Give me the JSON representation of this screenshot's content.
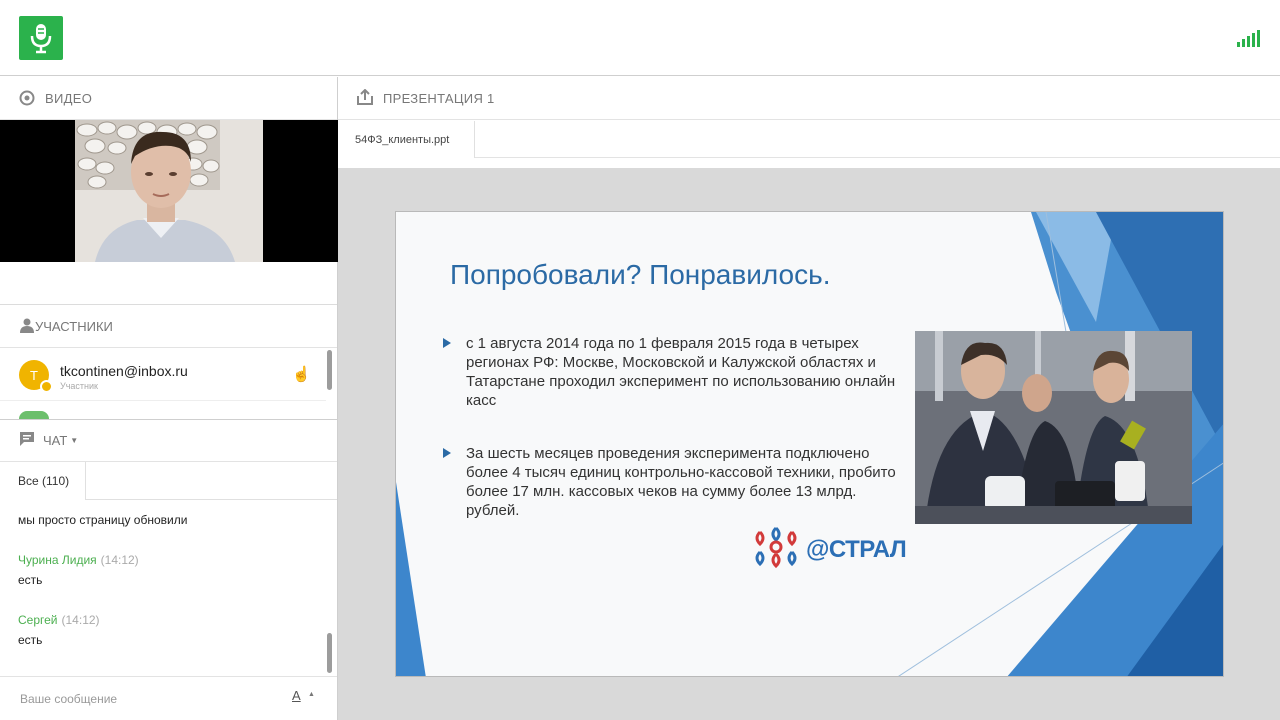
{
  "colors": {
    "brand_green": "#2bb24c",
    "accent_blue": "#2b6aa5",
    "author_green": "#4caf50"
  },
  "video": {
    "title": "ВИДЕО"
  },
  "participants": {
    "title": "УЧАСТНИКИ",
    "items": [
      {
        "initial": "T",
        "email": "tkcontinen@inbox.ru",
        "role": "Участник"
      }
    ]
  },
  "chat": {
    "title": "ЧАТ",
    "tab_all": "Все (110)",
    "messages": [
      {
        "author": "",
        "time": "",
        "text": "мы просто страницу обновили"
      },
      {
        "author": "Чурина Лидия",
        "time": "(14:12)",
        "text": "есть"
      },
      {
        "author": "Сергей",
        "time": "(14:12)",
        "text": "есть"
      }
    ],
    "input_placeholder": "Ваше сообщение",
    "format_label": "A"
  },
  "presentation": {
    "title": "ПРЕЗЕНТАЦИЯ 1",
    "file_tab": "54ФЗ_клиенты.ppt",
    "slide": {
      "title": "Попробовали? Понравилось.",
      "bullets": [
        "с 1 августа 2014 года по 1 февраля 2015 года в четырех регионах РФ: Москве, Московской и Калужской областях и Татарстане проходил эксперимент по использованию онлайн касс",
        "За шесть месяцев проведения эксперимента подключено более 4 тысяч единиц контрольно-кассовой техники, пробито более 17 млн. кассовых чеков на сумму более 13 млрд. рублей."
      ],
      "logo_text": "@СТРАЛ"
    }
  }
}
